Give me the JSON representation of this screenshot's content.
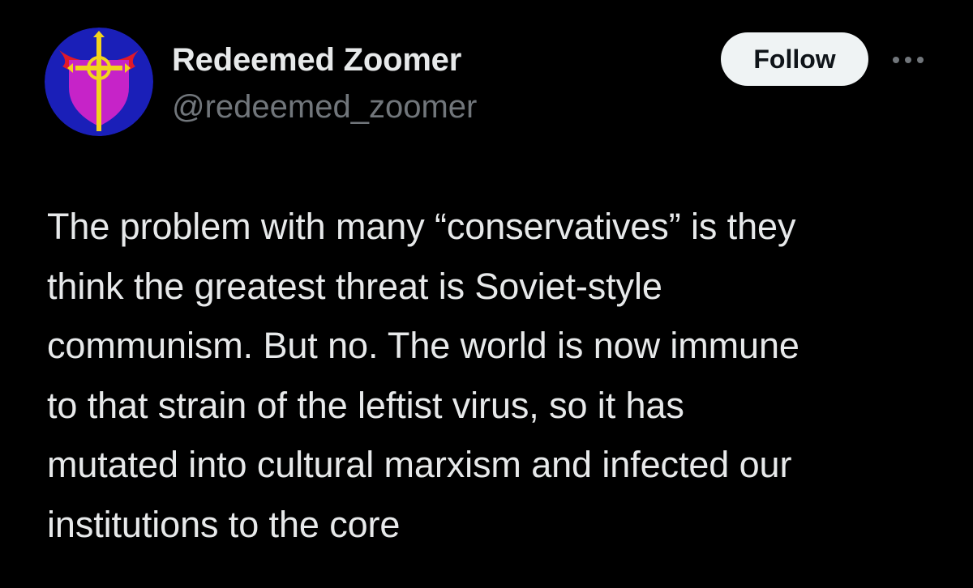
{
  "author": {
    "display_name": "Redeemed Zoomer",
    "handle": "@redeemed_zoomer",
    "avatar_icon": "cross-shield-avatar"
  },
  "actions": {
    "follow_label": "Follow",
    "more_icon": "more-horizontal-icon"
  },
  "post": {
    "lines": [
      "The problem with many “conservatives” is they",
      "think the greatest threat is Soviet-style",
      "communism. But no. The world is now immune",
      "to that strain of the leftist virus, so it has",
      "mutated into cultural marxism and infected our",
      "institutions to the core"
    ]
  },
  "colors": {
    "background": "#000000",
    "primary_text": "#e7e9ea",
    "secondary_text": "#71767b",
    "follow_button_bg": "#eff3f4",
    "follow_button_text": "#0f1419"
  }
}
